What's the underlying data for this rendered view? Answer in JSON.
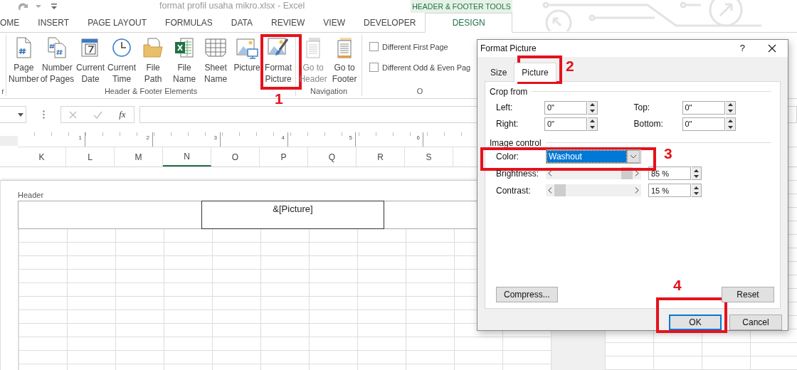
{
  "title_bar": {
    "title": "format profil usaha mikro.xlsx - Excel",
    "context_label": "HEADER & FOOTER TOOLS"
  },
  "tabs": [
    {
      "label": "OME",
      "selected": false
    },
    {
      "label": "INSERT",
      "selected": false
    },
    {
      "label": "PAGE LAYOUT",
      "selected": false
    },
    {
      "label": "FORMULAS",
      "selected": false
    },
    {
      "label": "DATA",
      "selected": false
    },
    {
      "label": "REVIEW",
      "selected": false
    },
    {
      "label": "VIEW",
      "selected": false
    },
    {
      "label": "DEVELOPER",
      "selected": false
    },
    {
      "label": "DESIGN",
      "selected": true
    }
  ],
  "ribbon": {
    "left_group_label": "r",
    "groups": [
      {
        "label": "Header & Footer Elements",
        "items": [
          {
            "kind": "page-number",
            "lines": [
              "Page",
              "Number"
            ],
            "disabled": false
          },
          {
            "kind": "number-of-pages",
            "lines": [
              "Number",
              "of Pages"
            ],
            "disabled": false
          },
          {
            "kind": "current-date",
            "lines": [
              "Current",
              "Date"
            ],
            "disabled": false
          },
          {
            "kind": "current-time",
            "lines": [
              "Current",
              "Time"
            ],
            "disabled": false
          },
          {
            "kind": "file-path",
            "lines": [
              "File",
              "Path"
            ],
            "disabled": false
          },
          {
            "kind": "file-name",
            "lines": [
              "File",
              "Name"
            ],
            "disabled": false
          },
          {
            "kind": "sheet-name",
            "lines": [
              "Sheet",
              "Name"
            ],
            "disabled": false
          },
          {
            "kind": "picture",
            "lines": [
              "Picture"
            ],
            "disabled": false
          },
          {
            "kind": "format-picture",
            "lines": [
              "Format",
              "Picture"
            ],
            "disabled": false
          }
        ]
      },
      {
        "label": "Navigation",
        "items": [
          {
            "kind": "go-to-header",
            "lines": [
              "Go to",
              "Header"
            ],
            "disabled": true
          },
          {
            "kind": "go-to-footer",
            "lines": [
              "Go to",
              "Footer"
            ],
            "disabled": false
          }
        ]
      }
    ],
    "options": {
      "label": "O",
      "checkboxes": [
        {
          "label": "Different First Page",
          "checked": false
        },
        {
          "label": "Different Odd & Even Pag",
          "checked": false
        }
      ]
    }
  },
  "formula_bar": {
    "function_label": "fx"
  },
  "ruler": {
    "marks": [
      "1",
      "2",
      "3",
      "4",
      "5",
      "6"
    ]
  },
  "columns": [
    {
      "label": "K",
      "selected": false
    },
    {
      "label": "L",
      "selected": false
    },
    {
      "label": "M",
      "selected": false
    },
    {
      "label": "N",
      "selected": true
    },
    {
      "label": "O",
      "selected": false
    },
    {
      "label": "P",
      "selected": false
    },
    {
      "label": "Q",
      "selected": false
    },
    {
      "label": "R",
      "selected": false
    },
    {
      "label": "S",
      "selected": false
    }
  ],
  "page": {
    "header_label": "Header",
    "header_center": "&[Picture]"
  },
  "dialog": {
    "title": "Format Picture",
    "help": "?",
    "tabs": [
      {
        "label": "Size",
        "selected": false
      },
      {
        "label": "Picture",
        "selected": true
      }
    ],
    "crop": {
      "label": "Crop from",
      "fields": [
        {
          "label": "Left:",
          "value": "0\""
        },
        {
          "label": "Top:",
          "value": "0\""
        },
        {
          "label": "Right:",
          "value": "0\""
        },
        {
          "label": "Bottom:",
          "value": "0\""
        }
      ]
    },
    "image_control": {
      "label": "Image control",
      "color": {
        "label": "Color:",
        "value": "Washout"
      },
      "sliders": [
        {
          "label": "Brightness:",
          "level": 0.85,
          "reading": "85 %"
        },
        {
          "label": "Contrast:",
          "level": 0.15,
          "reading": "15 %"
        }
      ]
    },
    "buttons": {
      "compress": "Compress...",
      "reset": "Reset",
      "ok": "OK",
      "cancel": "Cancel"
    }
  },
  "annotations": [
    {
      "label": "1"
    },
    {
      "label": "2"
    },
    {
      "label": "3"
    },
    {
      "label": "4"
    }
  ]
}
